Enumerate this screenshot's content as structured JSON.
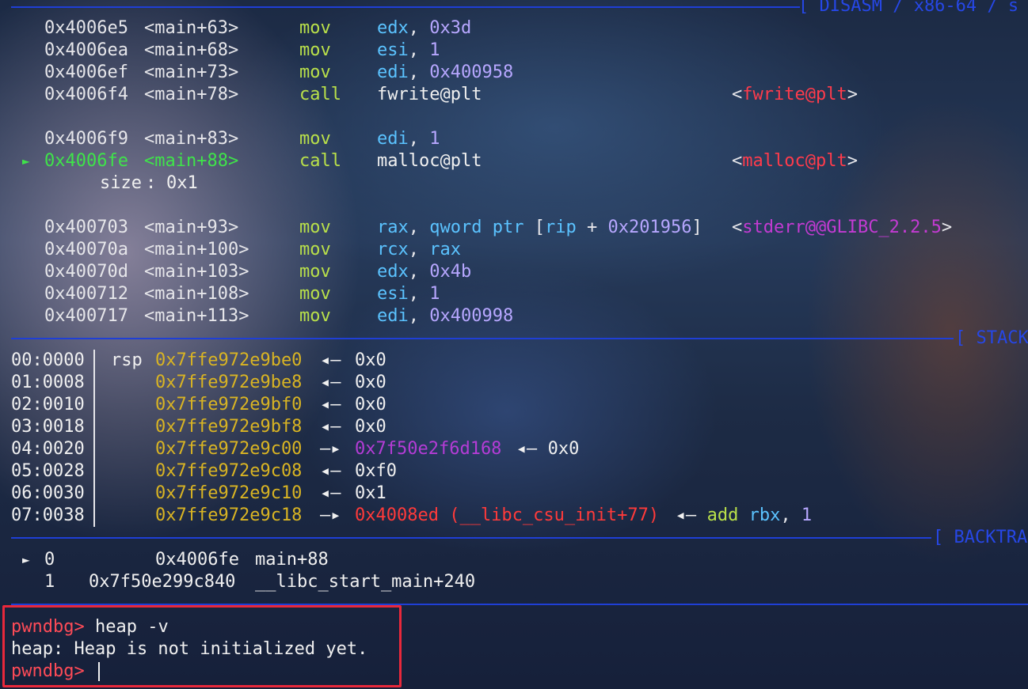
{
  "sections": {
    "disasm": "[ DISASM / x86-64 / s",
    "stack": "[ STACK",
    "backtrace": "[ BACKTRA"
  },
  "disasm": [
    {
      "addr": "0x4006e5",
      "sym": "<main+63>",
      "mnem": "mov",
      "op1": "edx",
      "op2": "0x3d"
    },
    {
      "addr": "0x4006ea",
      "sym": "<main+68>",
      "mnem": "mov",
      "op1": "esi",
      "op2": "1"
    },
    {
      "addr": "0x4006ef",
      "sym": "<main+73>",
      "mnem": "mov",
      "op1": "edi",
      "op2": "0x400958"
    },
    {
      "addr": "0x4006f4",
      "sym": "<main+78>",
      "mnem": "call",
      "op1": "fwrite@plt",
      "target": "fwrite@plt"
    },
    {
      "addr": "0x4006f9",
      "sym": "<main+83>",
      "mnem": "mov",
      "op1": "edi",
      "op2": "1"
    },
    {
      "marker": "►",
      "addr": "0x4006fe",
      "sym": "<main+88>",
      "mnem": "call",
      "op1": "malloc@plt",
      "target": "malloc@plt",
      "arg_name": "size",
      "arg_val": "0x1"
    },
    {
      "addr": "0x400703",
      "sym": "<main+93>",
      "mnem": "mov",
      "op1": "rax",
      "op2a": "qword",
      "op2b": "ptr",
      "op2c": "rip",
      "op2d": "0x201956",
      "target": "stderr@@GLIBC_2.2.5"
    },
    {
      "addr": "0x40070a",
      "sym": "<main+100>",
      "mnem": "mov",
      "op1": "rcx",
      "op2": "rax"
    },
    {
      "addr": "0x40070d",
      "sym": "<main+103>",
      "mnem": "mov",
      "op1": "edx",
      "op2": "0x4b"
    },
    {
      "addr": "0x400712",
      "sym": "<main+108>",
      "mnem": "mov",
      "op1": "esi",
      "op2": "1"
    },
    {
      "addr": "0x400717",
      "sym": "<main+113>",
      "mnem": "mov",
      "op1": "edi",
      "op2": "0x400998"
    }
  ],
  "stack": [
    {
      "idx": "00:0000",
      "reg": "rsp",
      "addr": "0x7ffe972e9be0",
      "arrow": "◂—",
      "val": "0x0"
    },
    {
      "idx": "01:0008",
      "reg": "",
      "addr": "0x7ffe972e9be8",
      "arrow": "◂—",
      "val": "0x0"
    },
    {
      "idx": "02:0010",
      "reg": "",
      "addr": "0x7ffe972e9bf0",
      "arrow": "◂—",
      "val": "0x0"
    },
    {
      "idx": "03:0018",
      "reg": "",
      "addr": "0x7ffe972e9bf8",
      "arrow": "◂—",
      "val": "0x0"
    },
    {
      "idx": "04:0020",
      "reg": "",
      "addr": "0x7ffe972e9c00",
      "arrow": "—▸",
      "ptr": "0x7f50e2f6d168",
      "arrow2": "◂—",
      "val": "0x0"
    },
    {
      "idx": "05:0028",
      "reg": "",
      "addr": "0x7ffe972e9c08",
      "arrow": "◂—",
      "val": "0xf0"
    },
    {
      "idx": "06:0030",
      "reg": "",
      "addr": "0x7ffe972e9c10",
      "arrow": "◂—",
      "val": "0x1"
    },
    {
      "idx": "07:0038",
      "reg": "",
      "addr": "0x7ffe972e9c18",
      "arrow": "—▸",
      "ptr": "0x4008ed (__libc_csu_init+77)",
      "arrow2": "◂—",
      "ins_mnem": "add",
      "ins_reg": "rbx",
      "ins_num": "1"
    }
  ],
  "backtrace": [
    {
      "marker": "►",
      "n": "0",
      "addr": "0x4006fe",
      "fn": "main+88"
    },
    {
      "marker": "",
      "n": "1",
      "addr": "0x7f50e299c840",
      "fn": "__libc_start_main+240"
    }
  ],
  "console": {
    "prompt": "pwndbg>",
    "command": "heap -v",
    "output": "heap: Heap is not initialized yet.",
    "prompt2": "pwndbg>"
  },
  "colors": {
    "separator": "#1f3fd6",
    "highlight_box": "#e8283b",
    "current_line": "#3fe34a",
    "mnemonic": "#b9e04a",
    "register": "#5bc3ff"
  }
}
